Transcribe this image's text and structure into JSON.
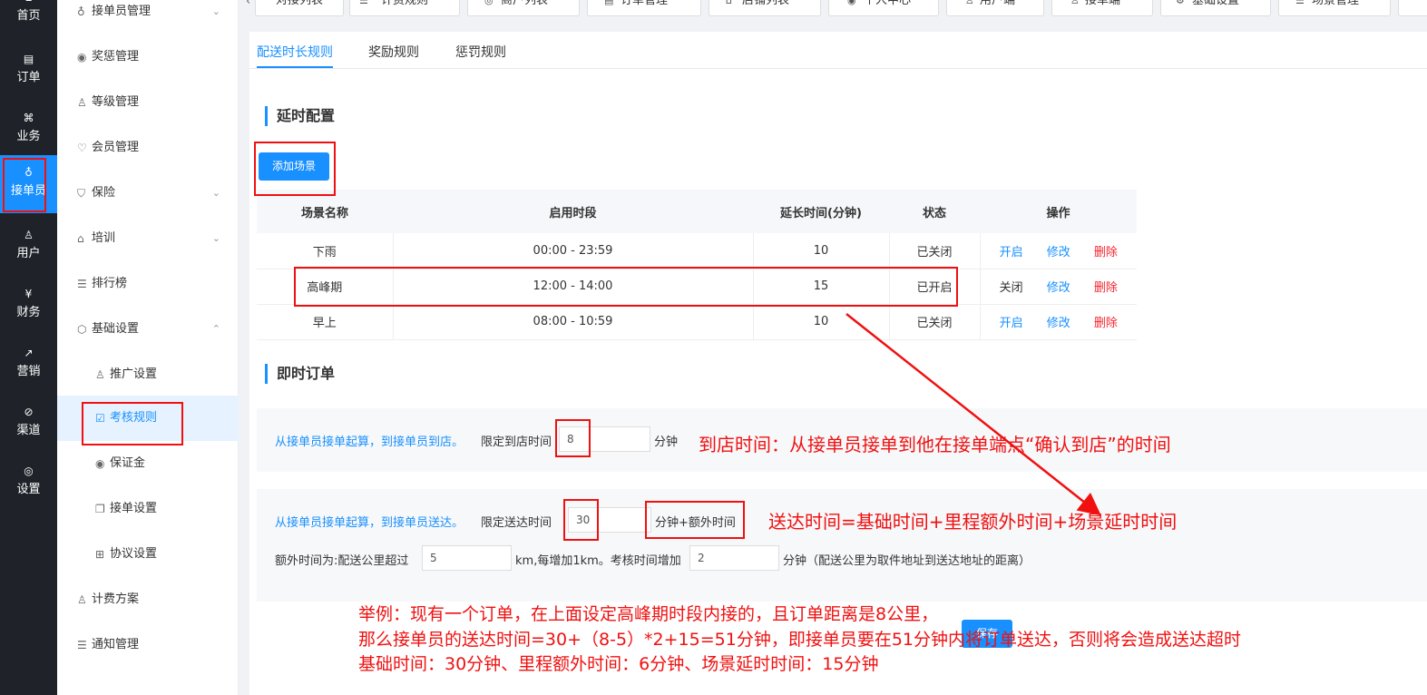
{
  "rail": [
    {
      "icon": "home-icon",
      "label": "首页"
    },
    {
      "icon": "order-icon",
      "label": "订单"
    },
    {
      "icon": "grid-icon",
      "label": "业务"
    },
    {
      "icon": "bike-icon",
      "label": "接单员"
    },
    {
      "icon": "user-icon",
      "label": "用户"
    },
    {
      "icon": "finance-icon",
      "label": "财务"
    },
    {
      "icon": "chart-icon",
      "label": "营销"
    },
    {
      "icon": "channel-icon",
      "label": "渠道"
    },
    {
      "icon": "settings-icon",
      "label": "设置"
    }
  ],
  "menu": [
    {
      "icon": "bike-icon",
      "label": "接单员管理"
    },
    {
      "icon": "medal-icon",
      "label": "奖惩管理"
    },
    {
      "icon": "level-icon",
      "label": "等级管理"
    },
    {
      "icon": "vip-icon",
      "label": "会员管理"
    },
    {
      "icon": "shield-icon",
      "label": "保险"
    },
    {
      "icon": "train-icon",
      "label": "培训"
    },
    {
      "icon": "list-icon",
      "label": "排行榜"
    },
    {
      "icon": "gear-icon",
      "label": "基础设置"
    },
    {
      "icon": "promo-icon",
      "label": "推广设置"
    },
    {
      "icon": "check-icon",
      "label": "考核规则"
    },
    {
      "icon": "deposit-icon",
      "label": "保证金"
    },
    {
      "icon": "copy-icon",
      "label": "接单设置"
    },
    {
      "icon": "book-icon",
      "label": "协议设置"
    },
    {
      "icon": "user-icon",
      "label": "计费方案"
    },
    {
      "icon": "list-icon",
      "label": "通知管理"
    }
  ],
  "top_tabs": [
    "对接列表",
    "计费规则",
    "商户列表",
    "订单管理",
    "店铺列表",
    "个人中心",
    "用户端",
    "接单端",
    "基础设置",
    "场景管理"
  ],
  "sub_tabs": [
    "配送时长规则",
    "奖励规则",
    "惩罚规则"
  ],
  "delay_section": {
    "title": "延时配置",
    "add_button": "添加场景",
    "columns": [
      "场景名称",
      "启用时段",
      "延长时间(分钟)",
      "状态",
      "操作"
    ],
    "rows": [
      {
        "name": "下雨",
        "period": "00:00 - 23:59",
        "minutes": "10",
        "status": "已关闭",
        "toggle": "开启",
        "edit": "修改",
        "delete": "删除"
      },
      {
        "name": "高峰期",
        "period": "12:00 - 14:00",
        "minutes": "15",
        "status": "已开启",
        "toggle": "关闭",
        "edit": "修改",
        "delete": "删除"
      },
      {
        "name": "早上",
        "period": "08:00 - 10:59",
        "minutes": "10",
        "status": "已关闭",
        "toggle": "开启",
        "edit": "修改",
        "delete": "删除"
      }
    ]
  },
  "instant_section": {
    "title": "即时订单",
    "store_row": {
      "desc": "从接单员接单起算，到接单员到店。",
      "label": "限定到店时间",
      "value": "8",
      "unit": "分钟"
    },
    "delivery_row": {
      "desc": "从接单员接单起算，到接单员送达。",
      "label": "限定送达时间",
      "value": "30",
      "unit": "分钟+额外时间"
    },
    "extra_row": {
      "prefix": "额外时间为:配送公里超过",
      "km_value": "5",
      "mid": "km,每增加1km。考核时间增加",
      "add_value": "2",
      "suffix": "分钟（配送公里为取件地址到送达地址的距离）"
    },
    "save_button": "保存"
  },
  "annotations": {
    "store_note": "到店时间：从接单员接单到他在接单端点“确认到店”的时间",
    "delivery_note": "送达时间=基础时间+里程额外时间+场景延时时间",
    "example_1": "举例：现有一个订单，在上面设定高峰期时段内接的，且订单距离是8公里，",
    "example_2": "那么接单员的送达时间=30+（8-5）*2+15=51分钟，即接单员要在51分钟内将订单送达，否则将会造成送达超时",
    "example_3": "基础时间：30分钟、里程额外时间：6分钟、场景延时时间：15分钟"
  },
  "colors": {
    "accent": "#1890ff",
    "annotation": "#f01010",
    "rail_bg": "#1f2329",
    "danger": "#f5222d"
  }
}
